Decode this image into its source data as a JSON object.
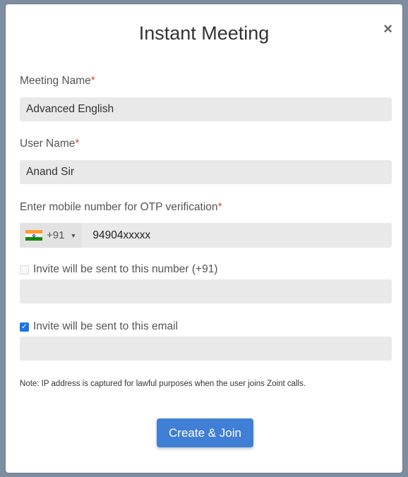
{
  "modal": {
    "title": "Instant Meeting",
    "close_icon": "×",
    "meeting_name_label": "Meeting Name",
    "meeting_name_value": "Advanced English",
    "user_name_label": "User Name",
    "user_name_value": "Anand Sir",
    "mobile_label": "Enter mobile number for OTP verification",
    "required_mark": "*",
    "country_code": "+91",
    "country_flag_icon": "india-flag-icon",
    "phone_value": "94904xxxxx",
    "invite_number_label": "Invite will be sent to this number (+91)",
    "invite_number_checked": false,
    "invite_number_value": "",
    "invite_email_label": "Invite will be sent to this email",
    "invite_email_checked": true,
    "invite_email_value": "",
    "note": "Note: IP address is captured for lawful purposes when the user joins Zoint calls.",
    "submit_label": "Create & Join"
  },
  "colors": {
    "primary_button": "#3f7fd6",
    "required": "#e0463f",
    "field_bg": "#e9e9e9"
  }
}
